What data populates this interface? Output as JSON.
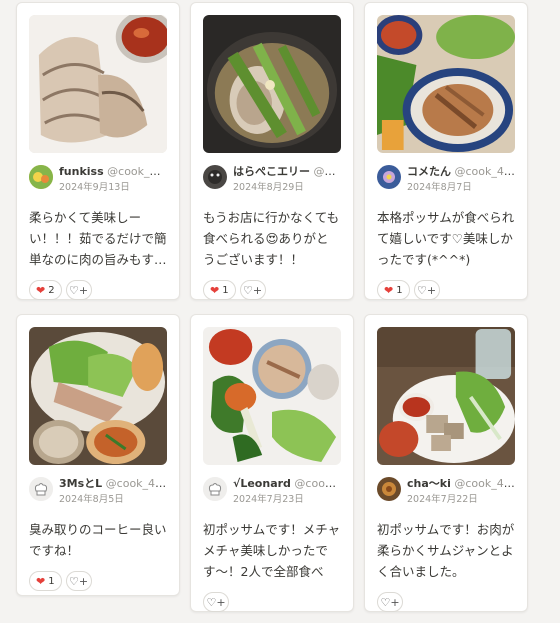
{
  "cards": [
    {
      "user": "funkiss",
      "handle": "@cook_400...",
      "date": "2024年9月13日",
      "comment": "柔らかくて美味しーい！！！茹でるだけで簡単なのに肉の旨みもす…",
      "likes": "2",
      "avatar": "fruit-avatar"
    },
    {
      "user": "はらぺこエリー",
      "handle": "@co...",
      "date": "2024年8月29日",
      "comment": "もうお店に行かなくても食べられる😍ありがとうございます！！",
      "likes": "1",
      "avatar": "pet-avatar"
    },
    {
      "user": "コメたん",
      "handle": "@cook_40...",
      "date": "2024年8月7日",
      "comment": "本格ポッサムが食べられて嬉しいです♡美味しかったです(*^^*)",
      "likes": "1",
      "avatar": "flower-avatar"
    },
    {
      "user": "3MsとL",
      "handle": "@cook_404...",
      "date": "2024年8月5日",
      "comment": "臭み取りのコーヒー良いですね！",
      "likes": "1",
      "avatar": "chef-hat-avatar"
    },
    {
      "user": "√Leonard",
      "handle": "@cook_4...",
      "date": "2024年7月23日",
      "comment": "初ポッサムです！メチャメチャ美味しかったです〜！2人で全部食べち…",
      "likes": "",
      "avatar": "chef-hat-avatar"
    },
    {
      "user": "cha〜ki",
      "handle": "@cook_400...",
      "date": "2024年7月22日",
      "comment": "初ポッサムです！お肉が柔らかくサムジャンとよく合いました。",
      "likes": "",
      "avatar": "food-avatar"
    }
  ],
  "icons": {
    "like": "heart-icon",
    "add_reaction": "heart-plus-icon"
  }
}
